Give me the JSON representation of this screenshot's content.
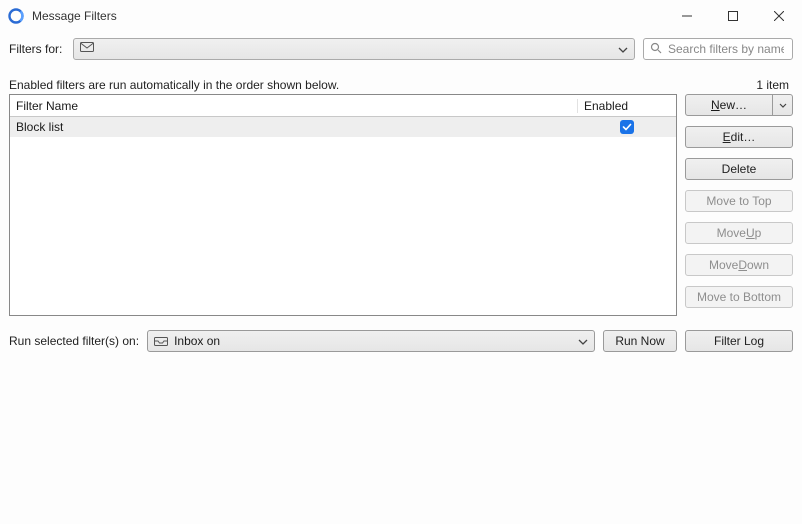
{
  "window": {
    "title": "Message Filters"
  },
  "filtersFor": {
    "label": "Filters for:",
    "searchPlaceholder": "Search filters by name…"
  },
  "description": "Enabled filters are run automatically in the order shown below.",
  "itemCount": "1 item",
  "columns": {
    "name": "Filter Name",
    "enabled": "Enabled"
  },
  "filters": [
    {
      "name": "Block list",
      "enabled": true
    }
  ],
  "buttons": {
    "new": "New…",
    "edit": "Edit…",
    "delete": "Delete",
    "moveTop": "Move to Top",
    "moveUp_pre": "Move ",
    "moveUp_u": "U",
    "moveUp_post": "p",
    "moveDown_pre": "Move ",
    "moveDown_u": "D",
    "moveDown_post": "own",
    "moveBottom": "Move to Bottom",
    "runNow": "Run Now",
    "filterLog": "Filter Log"
  },
  "runOn": {
    "label": "Run selected filter(s) on:",
    "folder": "Inbox on"
  }
}
